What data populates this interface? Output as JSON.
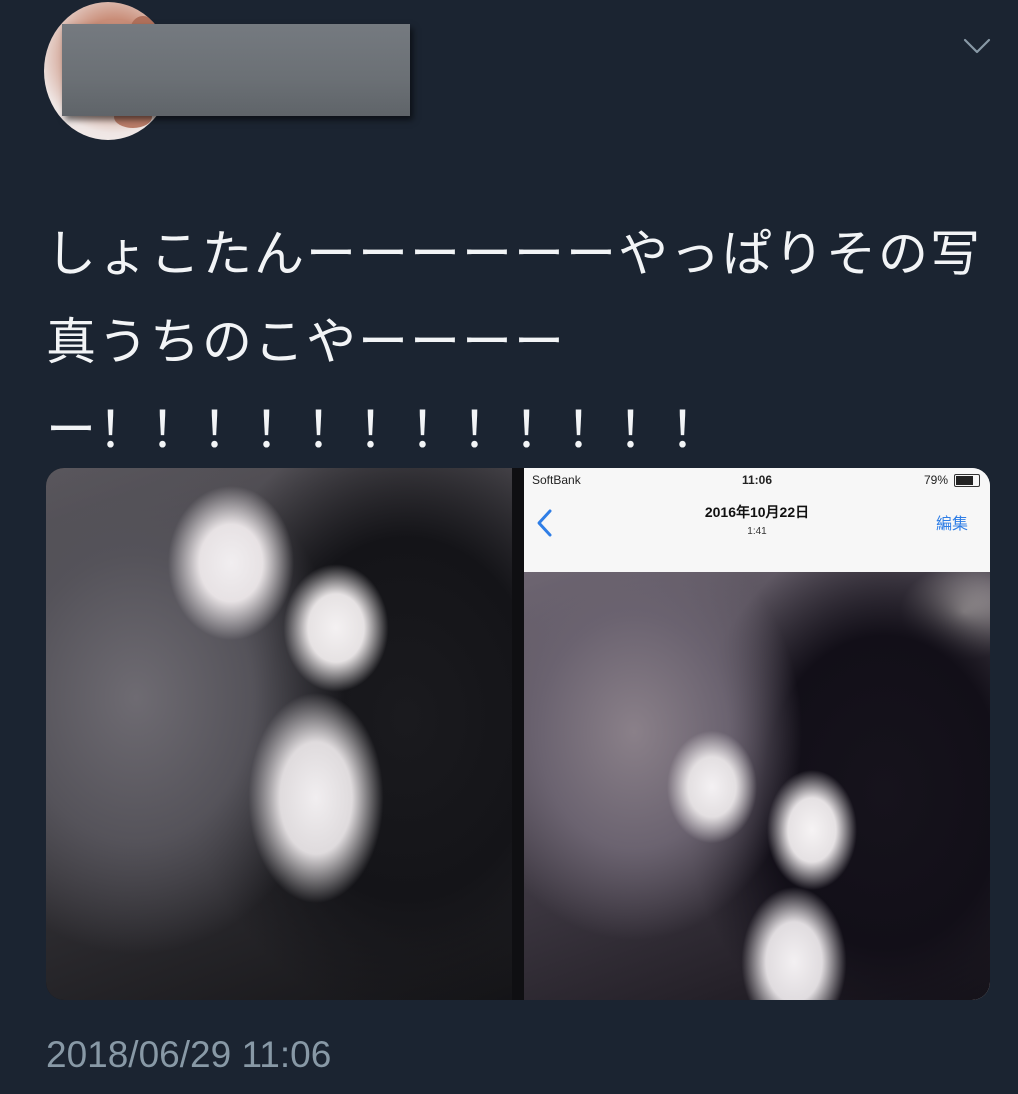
{
  "tweet": {
    "text": "しょこたんーーーーーーやっぱりその写真うちのこやーーーーー！！！！！！！！！！！！",
    "timestamp": "2018/06/29 11:06"
  },
  "header": {
    "more_icon": "chevron-down-icon"
  },
  "media": {
    "left_image": "cats-photo",
    "right_image": {
      "status_bar": {
        "carrier": "SoftBank",
        "time": "11:06",
        "battery_text": "79%",
        "battery_level": 0.79
      },
      "nav": {
        "date": "2016年10月22日",
        "time": "1:41",
        "edit_label": "編集",
        "back_icon": "chevron-left-icon"
      }
    }
  },
  "colors": {
    "background": "#1b2431",
    "text": "#f2f4f6",
    "muted": "#8899a6",
    "ios_blue": "#2f7ee6"
  }
}
